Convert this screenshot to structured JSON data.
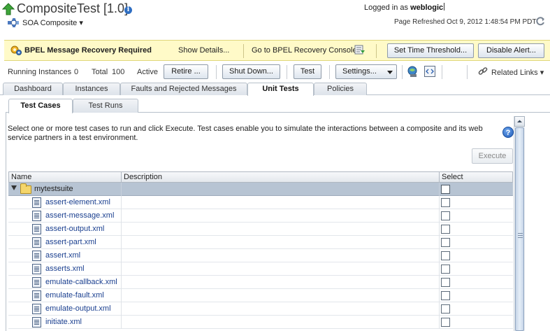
{
  "header": {
    "title": "CompositeTest [1.0]",
    "logged_in_prefix": "Logged in as",
    "username": "weblogic",
    "composite_menu": "SOA Composite ▾",
    "refreshed": "Page Refreshed Oct 9, 2012 1:48:54 PM PDT"
  },
  "alert": {
    "title": "BPEL Message Recovery Required",
    "show_details": "Show Details...",
    "go_to_console": "Go to BPEL Recovery Console",
    "set_threshold": "Set Time Threshold...",
    "disable_alert": "Disable Alert..."
  },
  "toolbar": {
    "running_label": "Running Instances",
    "running_value": "0",
    "total_label": "Total",
    "total_value": "100",
    "state": "Active",
    "retire": "Retire ...",
    "shutdown": "Shut Down...",
    "test": "Test",
    "settings": "Settings...",
    "related_links": "Related Links ▾"
  },
  "tabs": [
    "Dashboard",
    "Instances",
    "Faults and Rejected Messages",
    "Unit Tests",
    "Policies"
  ],
  "active_tab": "Unit Tests",
  "subtabs": [
    "Test Cases",
    "Test Runs"
  ],
  "active_subtab": "Test Cases",
  "content": {
    "description": "Select one or more test cases to run and click Execute. Test cases enable you to simulate the interactions between a composite and its web service partners in a test environment.",
    "execute": "Execute",
    "help": "?"
  },
  "table": {
    "columns": [
      "Name",
      "Description",
      "Select"
    ],
    "suite": "mytestsuite",
    "files": [
      "assert-element.xml",
      "assert-message.xml",
      "assert-output.xml",
      "assert-part.xml",
      "assert.xml",
      "asserts.xml",
      "emulate-callback.xml",
      "emulate-fault.xml",
      "emulate-output.xml",
      "initiate.xml"
    ]
  },
  "icons": {
    "up": "green-up-arrow-icon",
    "info": "info-icon",
    "composite": "soa-composite-icon",
    "refresh": "refresh-icon",
    "alert": "alert-gears-icon",
    "console": "console-link-icon",
    "test_deploy": "test-deploy-icon",
    "wsdl": "wsdl-icon",
    "related_links": "chain-link-icon"
  }
}
